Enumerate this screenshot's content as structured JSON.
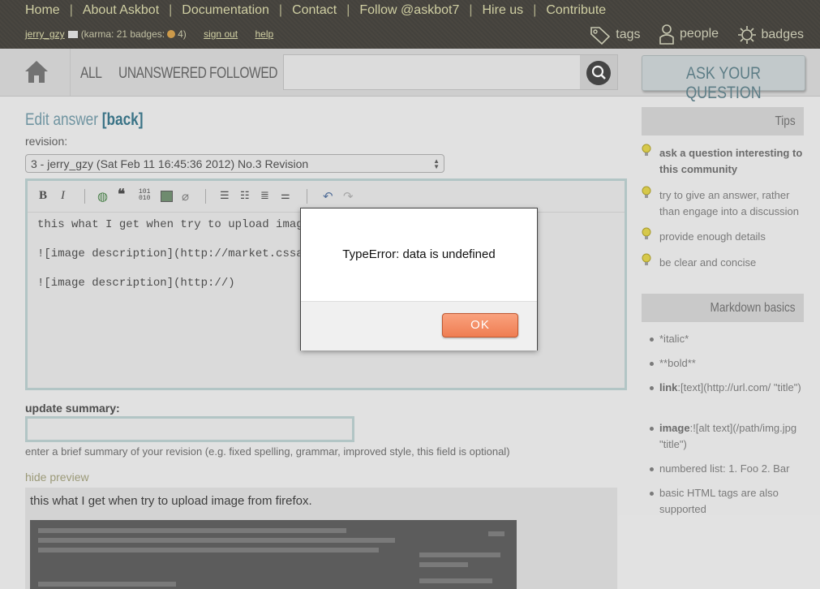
{
  "topnav": {
    "items": [
      "Home",
      "About Askbot",
      "Documentation",
      "Contact",
      "Follow @askbot7",
      "Hire us",
      "Contribute"
    ],
    "separator": "|"
  },
  "user": {
    "name": "jerry_gzy",
    "karma_text": "(karma: 21 badges:",
    "badge_count": "4)",
    "signout": "sign out",
    "help": "help"
  },
  "metanav": {
    "tags": "tags",
    "people": "people",
    "badges": "badges"
  },
  "scopes": {
    "all": "ALL",
    "unanswered": "UNANSWERED",
    "followed": "FOLLOWED"
  },
  "ask_button": "ASK YOUR QUESTION",
  "edit": {
    "title": "Edit answer",
    "back": "[back]",
    "revision_label": "revision:",
    "revision_selected": "3 - jerry_gzy (Sat Feb 11 16:45:36 2012) No.3 Revision",
    "editor_lines": [
      "this what I get when try to upload image",
      "![image description](http://market.cssaca",
      "![image description](http://)"
    ],
    "summary_label": "update summary:",
    "summary_hint": "enter a brief summary of your revision (e.g. fixed spelling, grammar, improved style, this field is optional)",
    "hide_preview": "hide preview",
    "preview_text": "this what I get when try to upload image from firefox."
  },
  "sidebar": {
    "tips_title": "Tips",
    "tips": [
      "ask a question interesting to this community",
      "try to give an answer, rather than engage into a discussion",
      "provide enough details",
      "be clear and concise"
    ],
    "markdown_title": "Markdown basics",
    "markdown": [
      {
        "bold": "",
        "text": "*italic*"
      },
      {
        "bold": "",
        "text": "**bold**"
      },
      {
        "bold": "link",
        "text": ":[text](http://url.com/ \"title\")"
      },
      {
        "bold": "image",
        "text": ":![alt text](/path/img.jpg \"title\")"
      },
      {
        "bold": "",
        "text": "numbered list: 1. Foo 2. Bar"
      },
      {
        "bold": "",
        "text": "basic HTML tags are also supported"
      }
    ]
  },
  "dialog": {
    "message": "TypeError: data is undefined",
    "ok": "OK"
  },
  "colors": {
    "topbar": "#3f3c34",
    "accent_blue": "#6b95a3",
    "ok_button": "#ef7d52"
  }
}
